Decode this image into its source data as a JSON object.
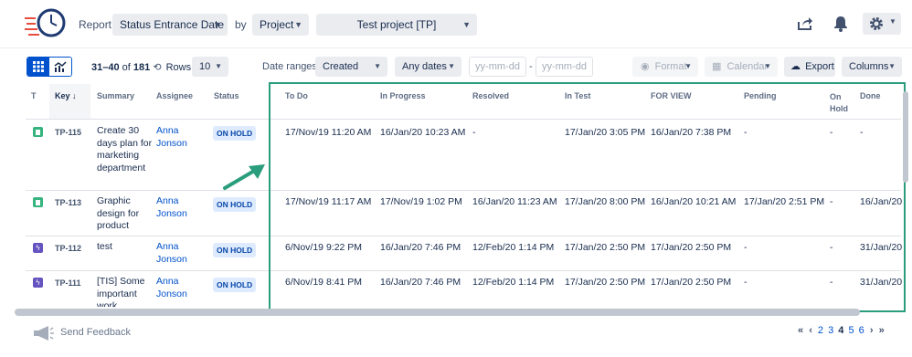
{
  "header": {
    "report_label": "Report:",
    "report_value": "Status Entrance Date",
    "by_label": "by",
    "group_value": "Project",
    "project_value": "Test project [TP]"
  },
  "toolbar": {
    "range_text": "31–40",
    "of_text": "of",
    "total": "181",
    "rows_label": "Rows:",
    "rows_value": "10",
    "date_ranges_label": "Date ranges:",
    "date_field": "Created",
    "date_period": "Any dates",
    "date_from_placeholder": "yy-mm-dd",
    "date_sep": "-",
    "date_to_placeholder": "yy-mm-dd",
    "format_label": "Format",
    "calendar_label": "Calendar",
    "export_label": "Export",
    "columns_label": "Columns"
  },
  "table": {
    "headers": {
      "type": "T",
      "key": "Key",
      "summary": "Summary",
      "assignee": "Assignee",
      "status": "Status",
      "todo": "To Do",
      "in_progress": "In Progress",
      "resolved": "Resolved",
      "in_test": "In Test",
      "for_view": "FOR VIEW",
      "pending": "Pending",
      "on_hold_1": "On",
      "on_hold_2": "Hold",
      "done": "Done"
    },
    "rows": [
      {
        "type": "story",
        "key": "TP-115",
        "summary": "Create 30 days plan for marketing department",
        "assignee": "Anna Jonson",
        "status": "ON HOLD",
        "todo": "17/Nov/19 11:20 AM",
        "in_progress": "16/Jan/20 10:23 AM",
        "resolved": "-",
        "in_test": "17/Jan/20 3:05 PM",
        "for_view": "16/Jan/20 7:38 PM",
        "pending": "-",
        "on_hold": "-",
        "done": "-"
      },
      {
        "type": "story",
        "key": "TP-113",
        "summary": "Graphic design for product",
        "assignee": "Anna Jonson",
        "status": "ON HOLD",
        "todo": "17/Nov/19 11:17 AM",
        "in_progress": "17/Nov/19 1:02 PM",
        "resolved": "16/Jan/20 11:23 AM",
        "in_test": "17/Jan/20 8:00 PM",
        "for_view": "16/Jan/20 10:21 AM",
        "pending": "17/Jan/20 2:51 PM",
        "on_hold": "-",
        "done": "16/Jan/20"
      },
      {
        "type": "epic",
        "key": "TP-112",
        "summary": "test",
        "assignee": "Anna Jonson",
        "status": "ON HOLD",
        "todo": "6/Nov/19 9:22 PM",
        "in_progress": "16/Jan/20 7:46 PM",
        "resolved": "12/Feb/20 1:14 PM",
        "in_test": "17/Jan/20 2:50 PM",
        "for_view": "17/Jan/20 2:50 PM",
        "pending": "-",
        "on_hold": "-",
        "done": "31/Jan/20"
      },
      {
        "type": "epic",
        "key": "TP-111",
        "summary": "[TIS] Some important work",
        "assignee": "Anna Jonson",
        "status": "ON HOLD",
        "todo": "6/Nov/19 8:41 PM",
        "in_progress": "16/Jan/20 7:46 PM",
        "resolved": "12/Feb/20 1:14 PM",
        "in_test": "17/Jan/20 2:50 PM",
        "for_view": "17/Jan/20 2:50 PM",
        "pending": "-",
        "on_hold": "-",
        "done": "31/Jan/20"
      }
    ]
  },
  "footer": {
    "feedback": "Send Feedback",
    "pages": [
      "2",
      "3",
      "4",
      "5",
      "6"
    ],
    "current_page": "4"
  },
  "colors": {
    "accent": "#0052cc",
    "highlight": "#2a9d7c",
    "story": "#36b37e",
    "epic": "#6554c0",
    "badge_bg": "#deebff"
  }
}
